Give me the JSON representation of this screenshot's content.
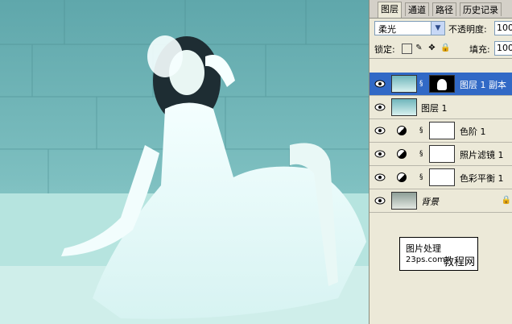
{
  "tabs": [
    {
      "label": "图层",
      "active": true
    },
    {
      "label": "通道",
      "active": false
    },
    {
      "label": "路径",
      "active": false
    },
    {
      "label": "历史记录",
      "active": false
    }
  ],
  "blend_mode": "柔光",
  "opacity_label": "不透明度:",
  "opacity_value": "100%",
  "lock_label": "锁定:",
  "fill_label": "填充:",
  "fill_value": "100%",
  "layers": [
    {
      "name": "图层 1 副本",
      "type": "image-with-mask",
      "selected": true
    },
    {
      "name": "图层 1",
      "type": "image",
      "selected": false
    },
    {
      "name": "色阶 1",
      "type": "adjustment",
      "selected": false
    },
    {
      "name": "照片滤镜 1",
      "type": "adjustment",
      "selected": false
    },
    {
      "name": "色彩平衡 1",
      "type": "adjustment",
      "selected": false
    },
    {
      "name": "背景",
      "type": "background",
      "selected": false
    }
  ],
  "watermark": {
    "line1": "图片处理",
    "line2": "23ps.com",
    "line3": "教程网"
  },
  "colors": {
    "selection": "#3169c6",
    "panel": "#ece9d8",
    "photo_tint": "#7fc2c4"
  }
}
